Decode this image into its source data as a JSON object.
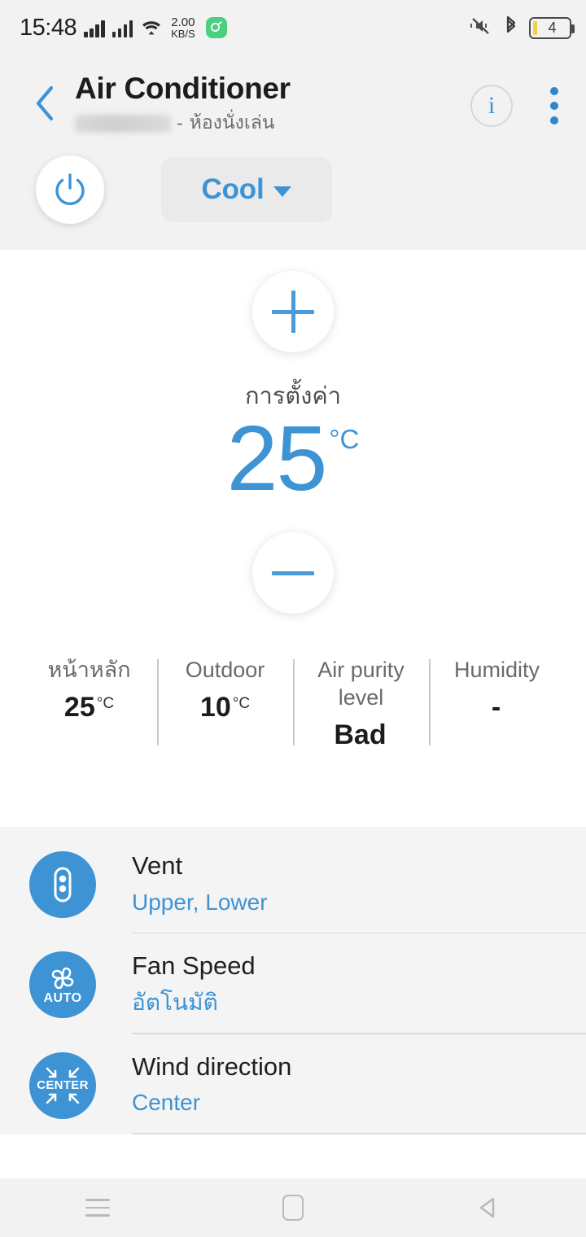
{
  "status_bar": {
    "time": "15:48",
    "net_speed_value": "2.00",
    "net_speed_unit": "KB/S",
    "battery_level": "4",
    "icons": [
      "signal-bars-sim1",
      "signal-bars-sim2",
      "wifi-icon",
      "app-badge-icon",
      "mute-icon",
      "bluetooth-icon",
      "battery-icon"
    ]
  },
  "header": {
    "back_icon": "chevron-left-icon",
    "title": "Air Conditioner",
    "subtitle_device": "",
    "subtitle_separator": "-",
    "subtitle_room": "ห้องนั่งเล่น",
    "info_icon_label": "i",
    "overflow_icon": "kebab-menu-icon"
  },
  "controls": {
    "power_icon": "power-icon",
    "mode_label": "Cool",
    "mode_caret": "chevron-down-icon"
  },
  "temperature": {
    "increase_icon": "plus-icon",
    "decrease_icon": "minus-icon",
    "set_label": "การตั้งค่า",
    "set_value": "25",
    "set_unit": "°C"
  },
  "stats": [
    {
      "label": "หน้าหลัก",
      "value": "25",
      "unit": "°C"
    },
    {
      "label": "Outdoor",
      "value": "10",
      "unit": "°C"
    },
    {
      "label": "Air purity level",
      "value": "Bad",
      "unit": ""
    },
    {
      "label": "Humidity",
      "value": "-",
      "unit": ""
    }
  ],
  "options": [
    {
      "icon": "vent-icon",
      "badge": "",
      "title": "Vent",
      "value": "Upper, Lower"
    },
    {
      "icon": "fan-icon",
      "badge": "AUTO",
      "title": "Fan Speed",
      "value": "อัตโนมัติ"
    },
    {
      "icon": "wind-direction-icon",
      "badge": "CENTER",
      "title": "Wind direction",
      "value": "Center"
    }
  ],
  "navbar": {
    "recents_icon": "menu-icon",
    "home_icon": "home-square-icon",
    "back_icon": "back-triangle-icon"
  },
  "colors": {
    "accent": "#3d93d4",
    "header_bg": "#f2f2f2",
    "content_bg": "#ffffff",
    "list_bg": "#f4f4f4",
    "battery_fill": "#f0d14b",
    "app_badge": "#4bd07f"
  }
}
